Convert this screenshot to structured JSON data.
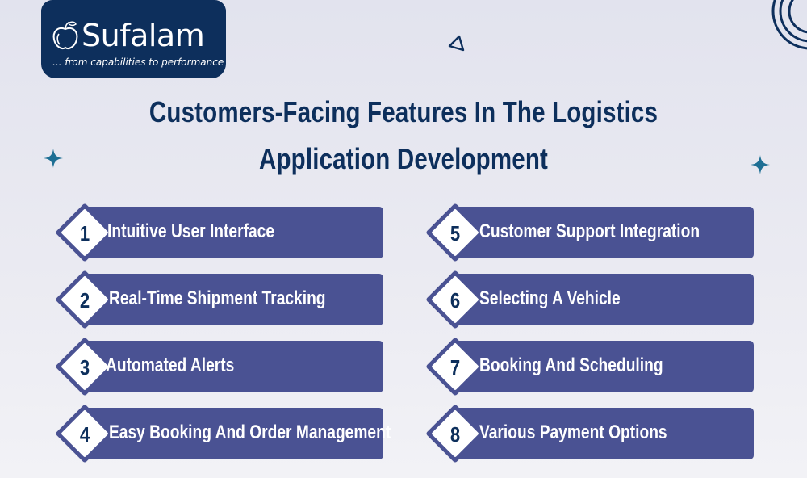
{
  "logo": {
    "name": "Sufalam",
    "tagline": "... from capabilities to performance"
  },
  "title": {
    "line1": "Customers-Facing Features In The Logistics",
    "line2": "Application Development"
  },
  "colors": {
    "brand_navy": "#0d2f5c",
    "card_purple": "#4a5293",
    "accent_teal": "#1e6f94"
  },
  "features": [
    {
      "number": "1",
      "label": "Intuitive User Interface"
    },
    {
      "number": "2",
      "label": "Real-Time Shipment Tracking"
    },
    {
      "number": "3",
      "label": "Automated Alerts"
    },
    {
      "number": "4",
      "label": "Easy Booking And Order Management"
    },
    {
      "number": "5",
      "label": "Customer Support Integration"
    },
    {
      "number": "6",
      "label": "Selecting A Vehicle"
    },
    {
      "number": "7",
      "label": "Booking And Scheduling"
    },
    {
      "number": "8",
      "label": "Various Payment Options"
    }
  ]
}
